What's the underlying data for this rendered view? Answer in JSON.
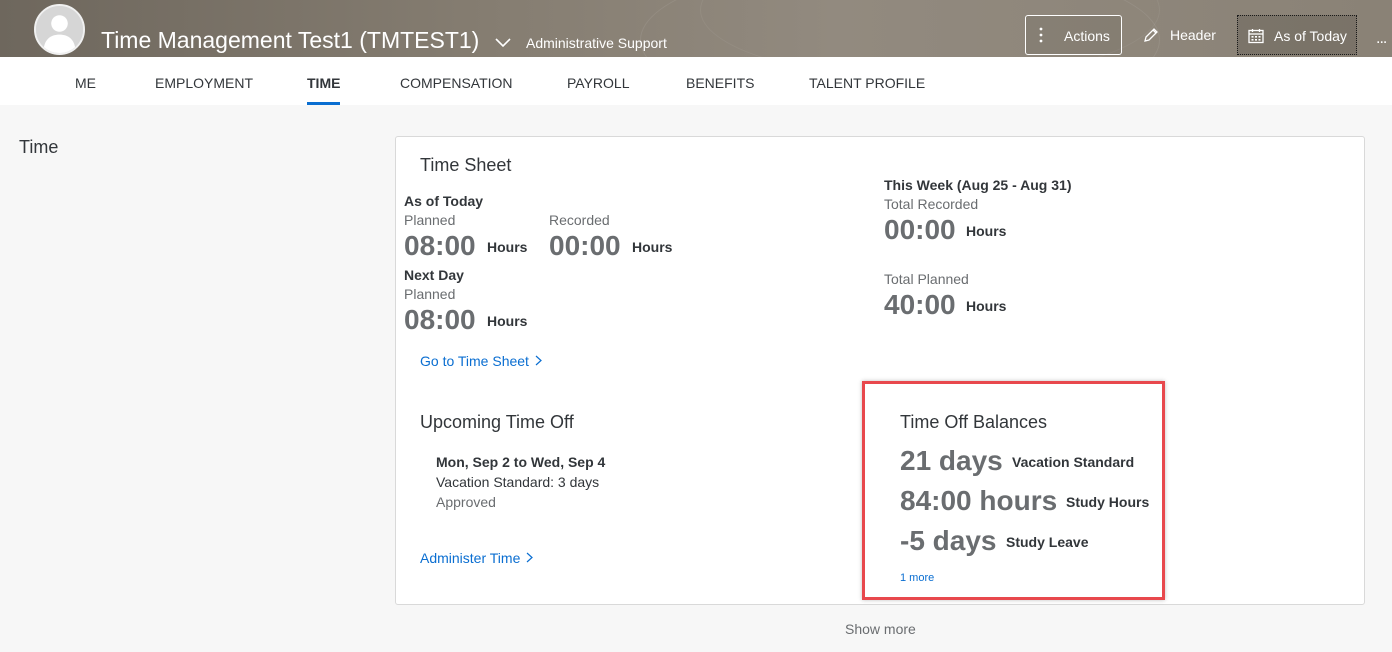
{
  "header": {
    "employee_name": "Time Management Test1 (TMTEST1)",
    "employee_role": "Administrative Support",
    "actions_label": "Actions",
    "header_label": "Header",
    "as_of_today_label": "As of Today",
    "more_label": "..."
  },
  "tabs": [
    {
      "label": "ME"
    },
    {
      "label": "EMPLOYMENT"
    },
    {
      "label": "TIME",
      "active": true
    },
    {
      "label": "COMPENSATION"
    },
    {
      "label": "PAYROLL"
    },
    {
      "label": "BENEFITS"
    },
    {
      "label": "TALENT PROFILE"
    }
  ],
  "section_title": "Time",
  "time_sheet": {
    "title": "Time Sheet",
    "as_of_today": "As of Today",
    "planned_label": "Planned",
    "planned_value": "08:00",
    "recorded_label": "Recorded",
    "recorded_value": "00:00",
    "hours_unit": "Hours",
    "next_day": "Next Day",
    "next_planned_label": "Planned",
    "next_planned_value": "08:00",
    "this_week": "This Week (Aug 25 - Aug 31)",
    "total_recorded_label": "Total Recorded",
    "total_recorded_value": "00:00",
    "total_planned_label": "Total Planned",
    "total_planned_value": "40:00",
    "go_link": "Go to Time Sheet"
  },
  "upcoming": {
    "title": "Upcoming Time Off",
    "date_range": "Mon, Sep 2 to Wed, Sep 4",
    "detail": "Vacation Standard: 3 days",
    "status": "Approved",
    "admin_link": "Administer Time"
  },
  "balances": {
    "title": "Time Off Balances",
    "items": [
      {
        "value": "21 days",
        "label": "Vacation Standard"
      },
      {
        "value": "84:00 hours",
        "label": "Study Hours"
      },
      {
        "value": "-5 days",
        "label": "Study Leave"
      }
    ],
    "more_link": "1 more"
  },
  "show_more": "Show more",
  "colors": {
    "accent": "#0a6ed1",
    "highlight": "#e8484d"
  }
}
